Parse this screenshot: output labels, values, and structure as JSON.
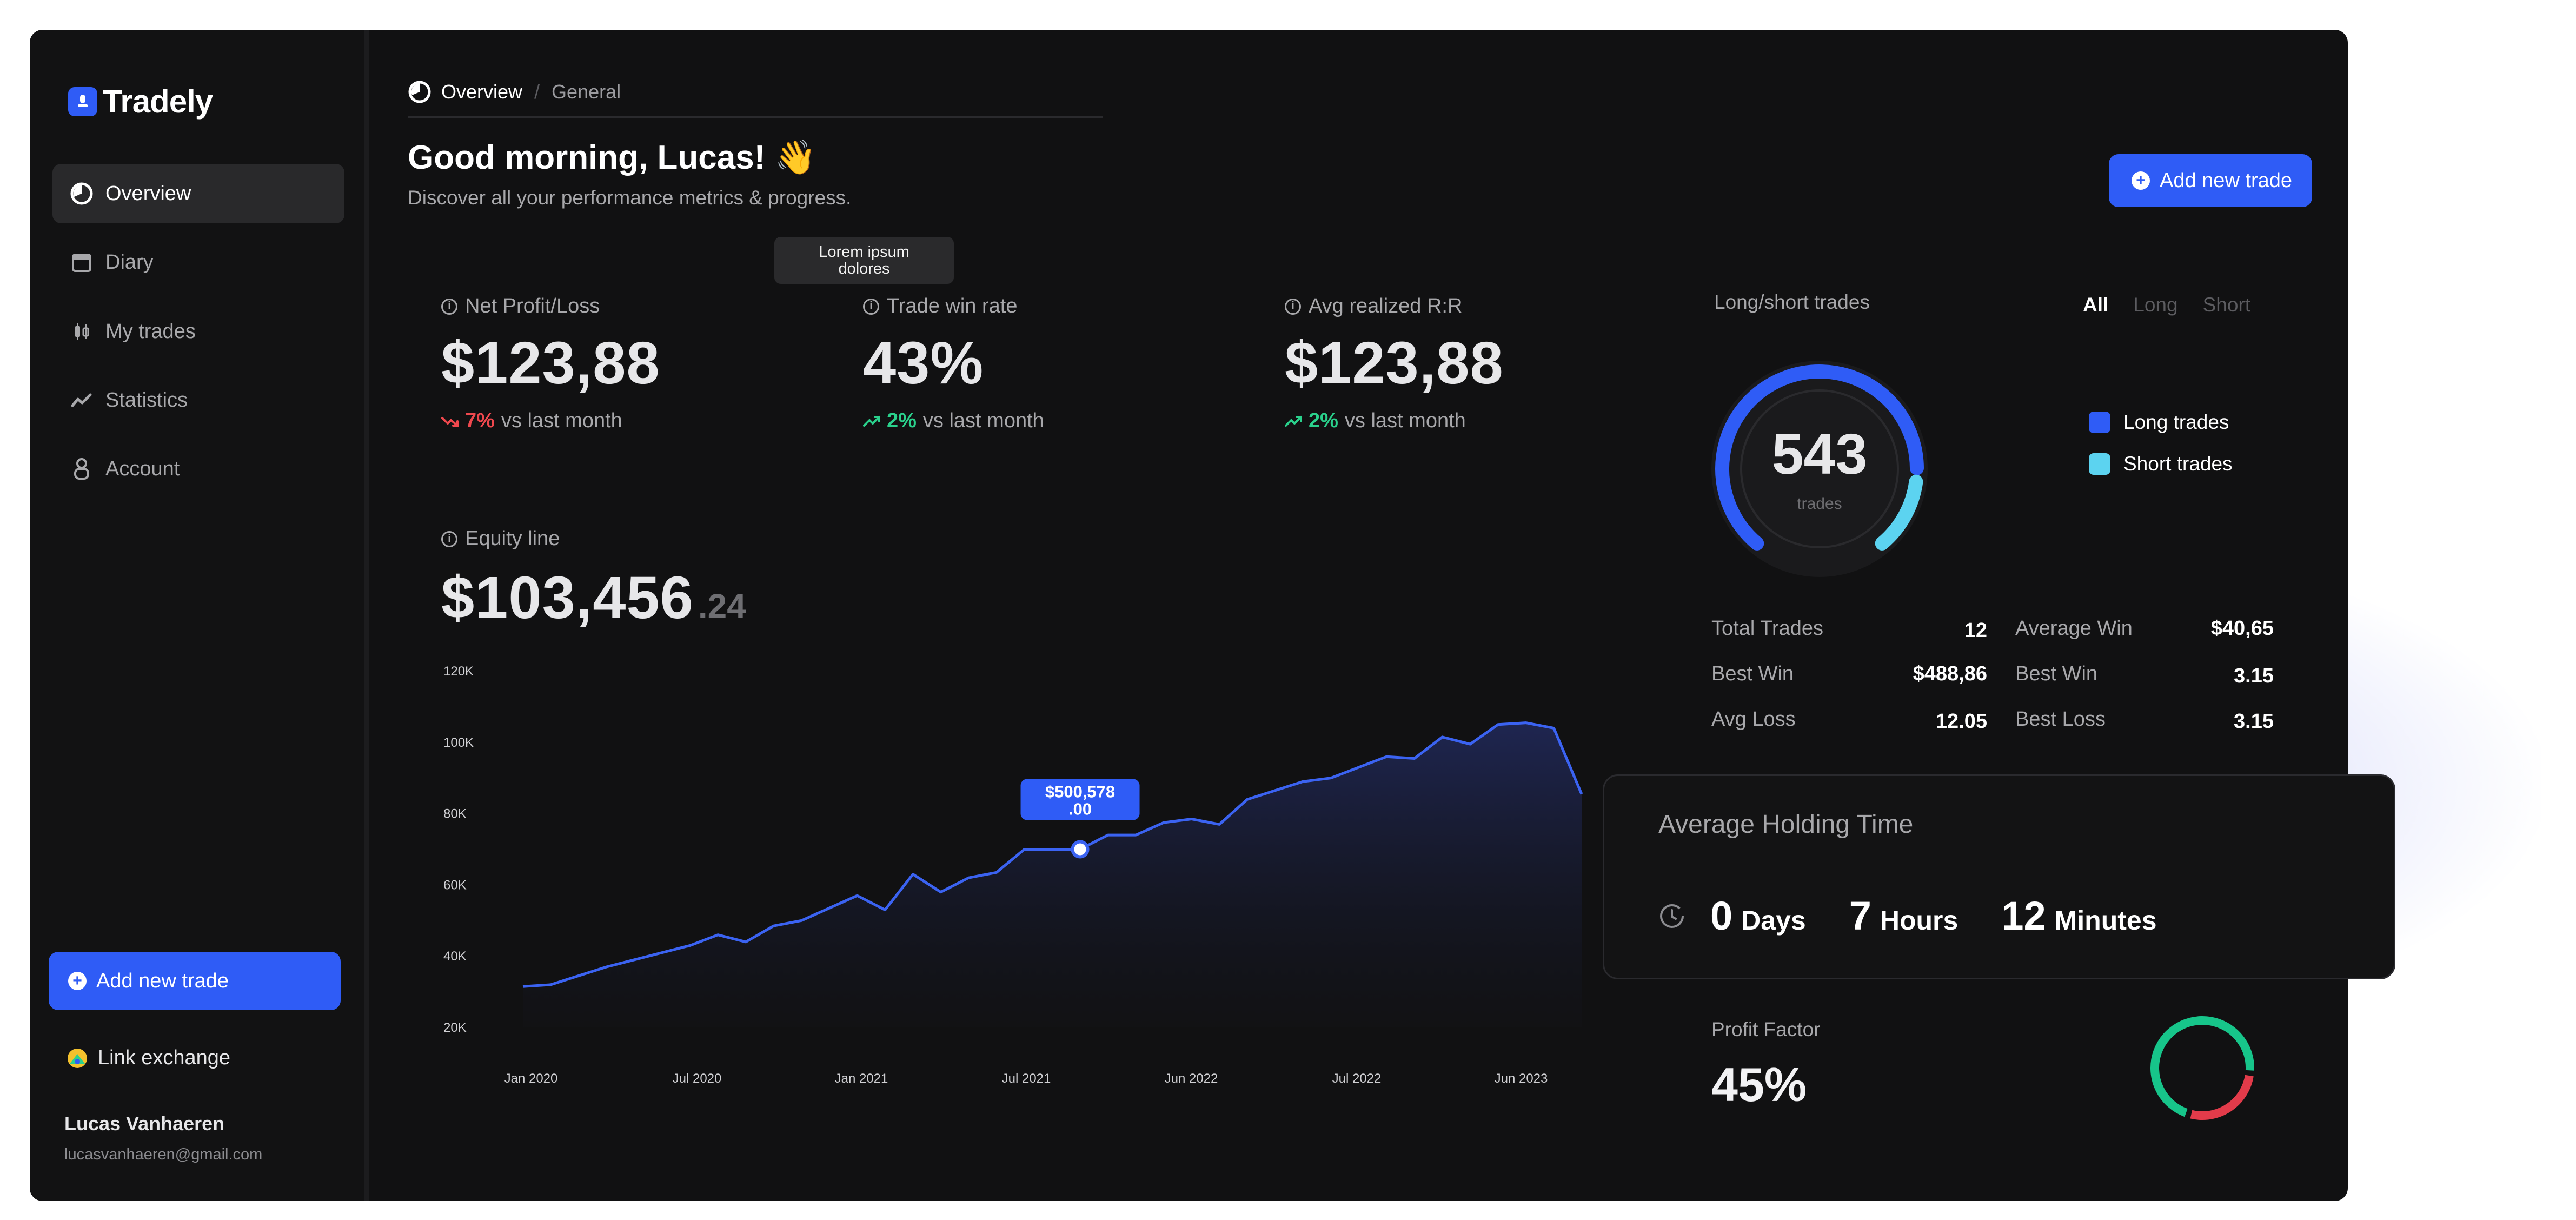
{
  "app": {
    "brand": "Tradely",
    "colors": {
      "accent": "#2f5cf6",
      "background": "#111112",
      "positive": "#2ad18c",
      "negative": "#f0484e",
      "long": "#2f5cf6",
      "short": "#5cd3f0"
    }
  },
  "sidebar": {
    "items": [
      {
        "label": "Overview",
        "icon": "gauge-icon",
        "active": true
      },
      {
        "label": "Diary",
        "icon": "calendar-icon",
        "active": false
      },
      {
        "label": "My trades",
        "icon": "candlestick-icon",
        "active": false
      },
      {
        "label": "Statistics",
        "icon": "trend-icon",
        "active": false
      },
      {
        "label": "Account",
        "icon": "user-icon",
        "active": false
      }
    ],
    "add_trade_label": "Add new trade",
    "link_exchange_label": "Link exchange",
    "user": {
      "name": "Lucas Vanhaeren",
      "email": "lucasvanhaeren@gmail.com"
    }
  },
  "header": {
    "breadcrumb": [
      "Overview",
      "General"
    ],
    "breadcrumb_separator": "/",
    "greeting": "Good morning, Lucas! 👋",
    "subtitle": "Discover all your performance metrics & progress.",
    "add_trade_label": "Add new trade",
    "tooltip": "Lorem ipsum dolores"
  },
  "metrics": [
    {
      "label": "Net Profit/Loss",
      "value": "$123,88",
      "delta": "7%",
      "delta_direction": "down",
      "delta_suffix": "vs last month"
    },
    {
      "label": "Trade win rate",
      "value": "43%",
      "delta": "2%",
      "delta_direction": "up",
      "delta_suffix": "vs last month"
    },
    {
      "label": "Avg realized R:R",
      "value": "$123,88",
      "delta": "2%",
      "delta_direction": "up",
      "delta_suffix": "vs last month"
    }
  ],
  "equity": {
    "label": "Equity line",
    "value_main": "$103,456",
    "value_cents": ".24",
    "tooltip_line1": "$500,578",
    "tooltip_line2": ".00"
  },
  "chart_data": {
    "type": "area",
    "title": "",
    "y_ticks": [
      "120K",
      "100K",
      "80K",
      "60K",
      "40K",
      "20K"
    ],
    "x_ticks": [
      "Jan 2020",
      "Jul 2020",
      "Jan 2021",
      "Jul 2021",
      "Jun 2022",
      "Jul 2022",
      "Jun 2023"
    ],
    "ylim": [
      20000,
      120000
    ],
    "values": [
      31500,
      32000,
      34500,
      37000,
      39000,
      41000,
      43000,
      46000,
      44000,
      48500,
      50000,
      53500,
      57000,
      53000,
      63000,
      58000,
      62000,
      63500,
      70000,
      70000,
      70000,
      74000,
      74000,
      77500,
      78500,
      77000,
      84000,
      86500,
      89000,
      90000,
      93000,
      96000,
      95500,
      101500,
      99500,
      105000,
      105500,
      104000,
      85500
    ],
    "highlight_index": 20
  },
  "long_short": {
    "title": "Long/short trades",
    "filters": [
      "All",
      "Long",
      "Short"
    ],
    "active_filter": "All",
    "total": "543",
    "total_label": "trades",
    "long_count_fraction": 0.82,
    "legend": [
      {
        "label": "Long trades",
        "color": "#2f5cf6"
      },
      {
        "label": "Short trades",
        "color": "#5cd3f0"
      }
    ]
  },
  "stats": [
    {
      "label": "Total Trades",
      "value": "12"
    },
    {
      "label": "Average Win",
      "value": "$40,65"
    },
    {
      "label": "Best Win",
      "value": "$488,86"
    },
    {
      "label": "Best Win",
      "value": "3.15"
    },
    {
      "label": "Avg Loss",
      "value": "12.05"
    },
    {
      "label": "Best Loss",
      "value": "3.15"
    }
  ],
  "holding_time": {
    "title": "Average Holding Time",
    "days": "0",
    "days_unit": "Days",
    "hours": "7",
    "hours_unit": "Hours",
    "minutes": "12",
    "minutes_unit": "Minutes"
  },
  "profit_factor": {
    "label": "Profit Factor",
    "value": "45%",
    "win_fraction": 0.72
  }
}
